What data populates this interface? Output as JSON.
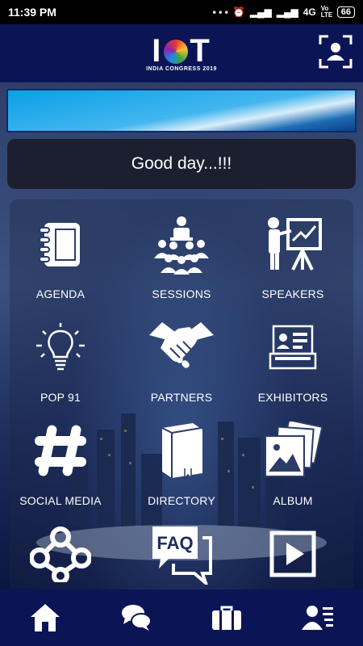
{
  "status_bar": {
    "time": "11:39 PM",
    "dots": "• • •",
    "network": "4G",
    "volte": "Vo LTE",
    "battery": "66"
  },
  "header": {
    "logo_text": "I  T",
    "logo_subtitle": "INDIA CONGRESS 2019",
    "scan_icon": "scan-user-icon"
  },
  "greeting": "Good day...!!!",
  "menu": [
    {
      "label": "AGENDA",
      "icon": "notebook-icon"
    },
    {
      "label": "SESSIONS",
      "icon": "audience-icon"
    },
    {
      "label": "SPEAKERS",
      "icon": "presenter-icon"
    },
    {
      "label": "POP 91",
      "icon": "lightbulb-icon"
    },
    {
      "label": "PARTNERS",
      "icon": "handshake-icon"
    },
    {
      "label": "EXHIBITORS",
      "icon": "exhibitor-booth-icon"
    },
    {
      "label": "SOCIAL MEDIA",
      "icon": "hashtag-icon"
    },
    {
      "label": "DIRECTORY",
      "icon": "book-icon"
    },
    {
      "label": "ALBUM",
      "icon": "photos-icon"
    },
    {
      "label": "",
      "icon": "network-nodes-icon"
    },
    {
      "label": "",
      "icon": "faq-icon"
    },
    {
      "label": "",
      "icon": "play-video-icon"
    }
  ],
  "faq_text": "FAQ",
  "bottom_nav": [
    {
      "name": "home",
      "icon": "home-icon"
    },
    {
      "name": "chat",
      "icon": "chat-icon"
    },
    {
      "name": "briefcase",
      "icon": "briefcase-icon"
    },
    {
      "name": "contacts",
      "icon": "contacts-icon"
    }
  ]
}
